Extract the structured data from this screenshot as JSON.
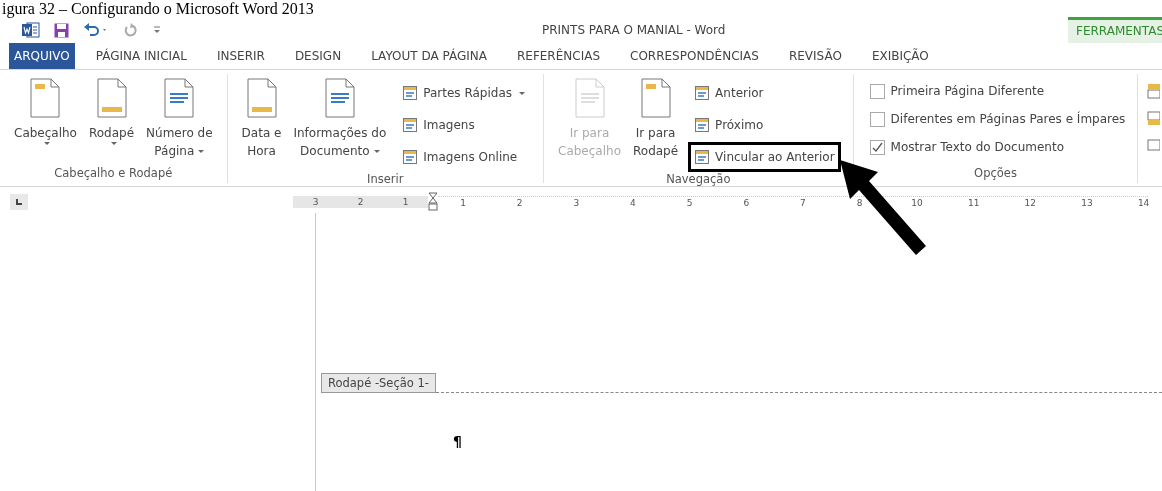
{
  "caption": "igura 32 – Configurando o Microsoft Word 2013",
  "window": {
    "title": "PRINTS PARA O MANIAL - Word"
  },
  "contextual_tab": {
    "label": "FERRAMENTAS"
  },
  "tabs": [
    {
      "label": "ARQUIVO",
      "kind": "file",
      "selected": false
    },
    {
      "label": "PÁGINA INICIAL",
      "kind": "normal",
      "selected": false
    },
    {
      "label": "INSERIR",
      "kind": "normal",
      "selected": false
    },
    {
      "label": "DESIGN",
      "kind": "normal",
      "selected": false
    },
    {
      "label": "LAYOUT DA PÁGINA",
      "kind": "normal",
      "selected": false
    },
    {
      "label": "REFERÊNCIAS",
      "kind": "normal",
      "selected": false
    },
    {
      "label": "CORRESPONDÊNCIAS",
      "kind": "normal",
      "selected": false
    },
    {
      "label": "REVISÃO",
      "kind": "normal",
      "selected": false
    },
    {
      "label": "EXIBIÇÃO",
      "kind": "normal",
      "selected": false
    }
  ],
  "ribbon_groups": [
    {
      "label": "Cabeçalho e Rodapé",
      "columns": [
        [
          {
            "kind": "large",
            "lines": [
              "Cabeçalho"
            ],
            "dropdown": true,
            "disabled": false
          }
        ],
        [
          {
            "kind": "large",
            "lines": [
              "Rodapé"
            ],
            "dropdown": true,
            "disabled": false
          }
        ],
        [
          {
            "kind": "large",
            "lines": [
              "Número de",
              "Página"
            ],
            "dropdown": true,
            "disabled": false
          }
        ]
      ]
    },
    {
      "label": "Inserir",
      "columns": [
        [
          {
            "kind": "large",
            "lines": [
              "Data e",
              "Hora"
            ],
            "dropdown": false,
            "disabled": false
          }
        ],
        [
          {
            "kind": "large",
            "lines": [
              "Informações do",
              "Documento"
            ],
            "dropdown": true,
            "disabled": false
          }
        ],
        [
          {
            "kind": "small",
            "label": "Partes Rápidas",
            "dropdown": true,
            "highlighted": false
          },
          {
            "kind": "small",
            "label": "Imagens",
            "dropdown": false,
            "highlighted": false
          },
          {
            "kind": "small",
            "label": "Imagens Online",
            "dropdown": false,
            "highlighted": false
          }
        ]
      ]
    },
    {
      "label": "Navegação",
      "columns": [
        [
          {
            "kind": "large",
            "lines": [
              "Ir para",
              "Cabeçalho"
            ],
            "dropdown": false,
            "disabled": true
          }
        ],
        [
          {
            "kind": "large",
            "lines": [
              "Ir para",
              "Rodapé"
            ],
            "dropdown": false,
            "disabled": false
          }
        ],
        [
          {
            "kind": "small",
            "label": "Anterior",
            "dropdown": false,
            "highlighted": false
          },
          {
            "kind": "small",
            "label": "Próximo",
            "dropdown": false,
            "highlighted": false
          },
          {
            "kind": "small",
            "label": "Vincular ao Anterior",
            "dropdown": false,
            "highlighted": true
          }
        ]
      ]
    },
    {
      "label": "Opções",
      "columns": [
        [
          {
            "kind": "check",
            "label": "Primeira Página Diferente",
            "checked": false
          },
          {
            "kind": "check",
            "label": "Diferentes em Páginas Pares e Ímpares",
            "checked": false
          },
          {
            "kind": "check",
            "label": "Mostrar Texto do Documento",
            "checked": true
          }
        ]
      ]
    }
  ],
  "ruler": {
    "left_labels": [
      "3",
      "2",
      "1"
    ],
    "right_labels": [
      "1",
      "2",
      "3",
      "4",
      "5",
      "6",
      "7",
      "8",
      "10",
      "11",
      "12",
      "13",
      "14"
    ]
  },
  "document": {
    "footer_tag": "Rodapé -Seção 1-",
    "paragraph_mark": "¶"
  }
}
